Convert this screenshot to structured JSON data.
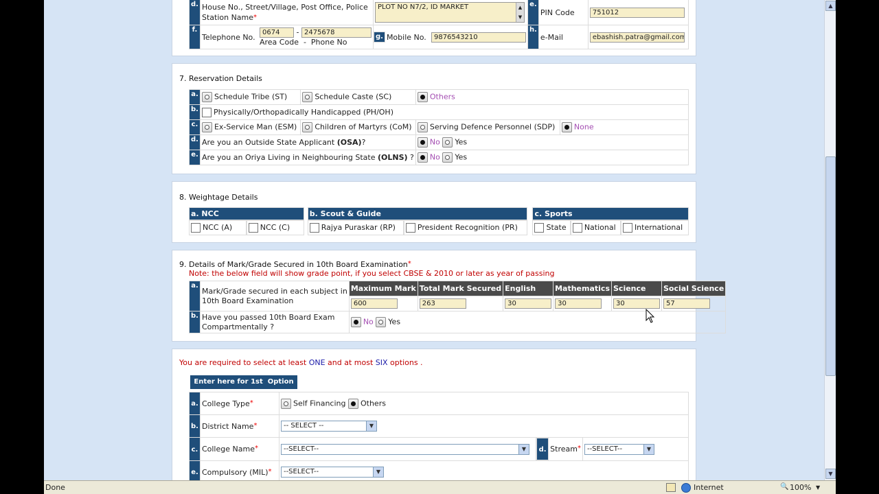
{
  "section_contact": {
    "d": {
      "letter": "d.",
      "label": "House No., Street/Village, Post Office, Police Station Name",
      "value": "PLOT NO N7/2, ID MARKET"
    },
    "e": {
      "letter": "e.",
      "label": "PIN Code",
      "value": "751012"
    },
    "f": {
      "letter": "f.",
      "label": "Telephone No.",
      "area_value": "0674",
      "dash": "-",
      "phone_value": "2475678",
      "sublabel": "Area Code  -  Phone No"
    },
    "g": {
      "letter": "g.",
      "label": "Mobile No.",
      "value": "9876543210"
    },
    "h": {
      "letter": "h.",
      "label": "e-Mail",
      "value": "ebashish.patra@gmail.com"
    }
  },
  "reservation": {
    "title": "7.  Reservation Details",
    "rows": [
      {
        "letter": "a.",
        "options": [
          {
            "label": "Schedule Tribe (ST)",
            "checked": false
          },
          {
            "label": "Schedule Caste (SC)",
            "checked": false
          },
          {
            "label": "Others",
            "checked": true
          }
        ]
      },
      {
        "letter": "b.",
        "checkbox_label": "Physically/Orthopadically Handicapped (PH/OH)"
      },
      {
        "letter": "c.",
        "options": [
          {
            "label": "Ex-Service Man (ESM)",
            "checked": false
          },
          {
            "label": "Children of Martyrs (CoM)",
            "checked": false
          },
          {
            "label": "Serving Defence Personnel (SDP)",
            "checked": false
          },
          {
            "label": "None",
            "checked": true
          }
        ]
      },
      {
        "letter": "d.",
        "question_pre": "Are you an Outside State Applicant ",
        "question_bold": "(OSA)",
        "question_post": "?",
        "no": "No",
        "yes": "Yes"
      },
      {
        "letter": "e.",
        "question_pre": "Are you an Oriya Living in Neighbouring State ",
        "question_bold": "(OLNS)",
        "question_post": " ?",
        "no": "No",
        "yes": "Yes"
      }
    ]
  },
  "weightage": {
    "title": "8. Weightage Details",
    "groups": [
      {
        "header": "a. NCC",
        "items": [
          "NCC (A)",
          "NCC (C)"
        ]
      },
      {
        "header": "b. Scout & Guide",
        "items": [
          "Rajya Puraskar (RP)",
          "President Recognition (PR)"
        ]
      },
      {
        "header": "c. Sports",
        "items": [
          "State",
          "National",
          "International"
        ]
      }
    ]
  },
  "marks": {
    "number": "9.",
    "title": "Details of Mark/Grade Secured in 10th Board Examination",
    "note": "Note: the below field will show grade point, if you select CBSE & 2010 or later as year of passing",
    "row_a": {
      "letter": "a.",
      "label_line1": "Mark/Grade secured in each subject in",
      "label_line2": "10th Board Examination"
    },
    "columns": [
      "Maximum Mark",
      "Total Mark Secured",
      "English",
      "Mathematics",
      "Science",
      "Social Science"
    ],
    "values": [
      "600",
      "263",
      "30",
      "30",
      "30",
      "57"
    ],
    "row_b": {
      "letter": "b.",
      "label_line1": "Have you passed 10th Board Exam",
      "label_line2": "Compartmentally ?",
      "no": "No",
      "yes": "Yes"
    }
  },
  "options": {
    "notice_pre": "You are required to select at least ",
    "notice_one": "ONE",
    "notice_mid": " and at most ",
    "notice_six": "SIX",
    "notice_post": " options .",
    "first_option_tab": "Enter here for 1st  Option",
    "college_type": {
      "letter": "a.",
      "label": "College Type",
      "opt1": "Self Financing",
      "opt2": "Others"
    },
    "district": {
      "letter": "b.",
      "label": "District Name",
      "value": "-- SELECT --"
    },
    "college_name": {
      "letter": "c.",
      "label": "College Name",
      "value": "--SELECT--"
    },
    "stream": {
      "letter": "d.",
      "label": "Stream",
      "value": "--SELECT--"
    },
    "compulsory": {
      "letter": "e.",
      "label": "Compulsory (MIL)",
      "value": "--SELECT--"
    }
  },
  "status_bar": {
    "left": "Done",
    "zone": "Internet",
    "zoom": "100%"
  }
}
